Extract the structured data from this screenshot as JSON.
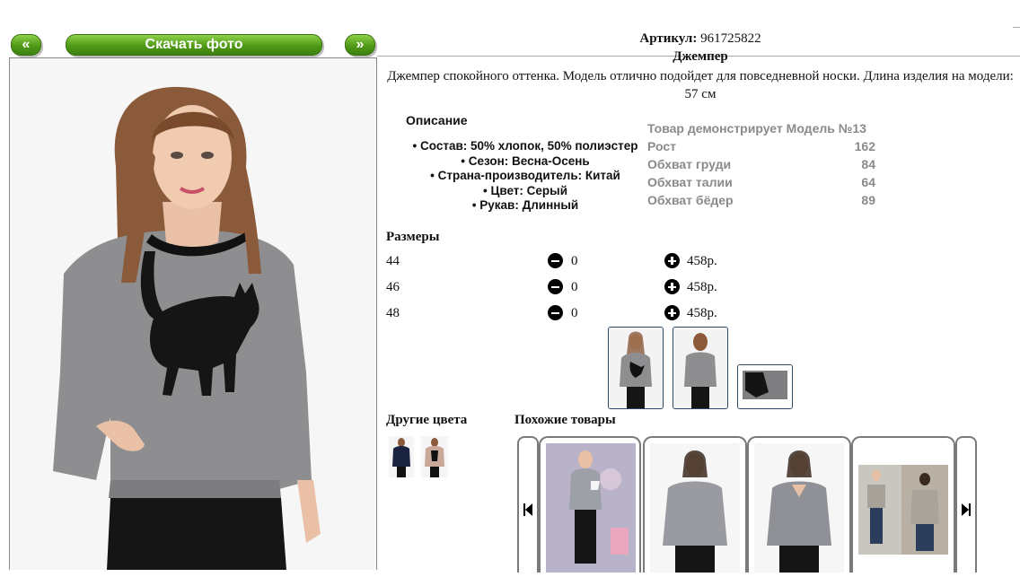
{
  "gallery": {
    "prev_label": "«",
    "download_label": "Скачать фото",
    "next_label": "»"
  },
  "product": {
    "article_label": "Артикул:",
    "article_value": "961725822",
    "name": "Джемпер",
    "description": "Джемпер спокойного оттенка. Модель отлично подойдет для повседневной носки. Длина изделия на модели: 57 см"
  },
  "specs": {
    "heading": "Описание",
    "items": [
      "Состав: 50% хлопок, 50% полиэстер",
      "Сезон: Весна-Осень",
      "Страна-производитель: Китай",
      "Цвет: Серый",
      "Рукав: Длинный"
    ]
  },
  "model": {
    "heading": "Товар демонстрирует Модель №13",
    "rows": [
      {
        "label": "Рост",
        "value": "162"
      },
      {
        "label": "Обхват груди",
        "value": "84"
      },
      {
        "label": "Обхват талии",
        "value": "64"
      },
      {
        "label": "Обхват бёдер",
        "value": "89"
      }
    ]
  },
  "sizes": {
    "heading": "Размеры",
    "rows": [
      {
        "size": "44",
        "qty": "0",
        "price": "458р."
      },
      {
        "size": "46",
        "qty": "0",
        "price": "458р."
      },
      {
        "size": "48",
        "qty": "0",
        "price": "458р."
      }
    ]
  },
  "other_colors": {
    "heading": "Другие цвета"
  },
  "similar": {
    "heading": "Похожие товары"
  },
  "colors": {
    "button_green": "#4f9a16",
    "sweater_gray": "#8e8e90",
    "model_label_gray": "#8a8a8a",
    "thumb_border": "#2b4a66"
  }
}
